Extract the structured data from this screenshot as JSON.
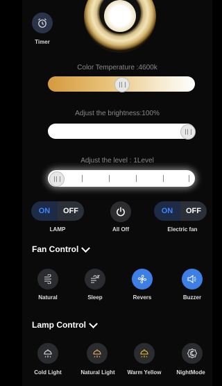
{
  "timer": {
    "label": "Timer"
  },
  "color_temperature": {
    "caption": "Color Temperature :4600k",
    "value_fraction": 0.5
  },
  "brightness": {
    "caption": "Adjust the brightness:100%",
    "value_fraction": 1.0
  },
  "level": {
    "caption": "Adjust the level : 1Level",
    "value_fraction": 0.0
  },
  "lamp_toggle": {
    "on": "ON",
    "off": "OFF",
    "label": "LAMP",
    "state": "ON"
  },
  "all_off": {
    "label": "All Off"
  },
  "fan_toggle": {
    "on": "ON",
    "off": "OFF",
    "label": "Electric fan",
    "state": "OFF"
  },
  "fan_control": {
    "title": "Fan Control",
    "items": [
      {
        "label": "Natural",
        "icon": "wind-icon",
        "active": false
      },
      {
        "label": "Sleep",
        "icon": "sleep-wind-icon",
        "active": false
      },
      {
        "label": "Revers",
        "icon": "fan-icon",
        "active": true
      },
      {
        "label": "Buzzer",
        "icon": "speaker-icon",
        "active": true
      }
    ]
  },
  "lamp_control": {
    "title": "Lamp Control",
    "items": [
      {
        "label": "Cold Light",
        "icon": "lamp-icon",
        "color": "#e8e8e8"
      },
      {
        "label": "Natural Light",
        "icon": "lamp-icon",
        "color": "#f0b86a"
      },
      {
        "label": "Warm Yellow",
        "icon": "lamp-icon",
        "color": "#f2c234"
      },
      {
        "label": "NightMode",
        "icon": "night-mode-icon",
        "color": "#e8e8e8"
      }
    ]
  }
}
